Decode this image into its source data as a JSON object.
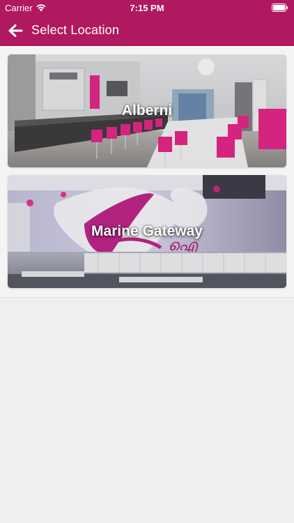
{
  "status_bar": {
    "carrier": "Carrier",
    "time": "7:15 PM",
    "wifi_icon": "wifi-icon",
    "battery_icon": "battery-icon"
  },
  "nav": {
    "back_icon": "arrow-left-icon",
    "title": "Select Location"
  },
  "theme": {
    "header_color": "#b0195f",
    "accent_pink": "#e8288a"
  },
  "locations": [
    {
      "name": "Alberni"
    },
    {
      "name": "Marine Gateway"
    }
  ]
}
